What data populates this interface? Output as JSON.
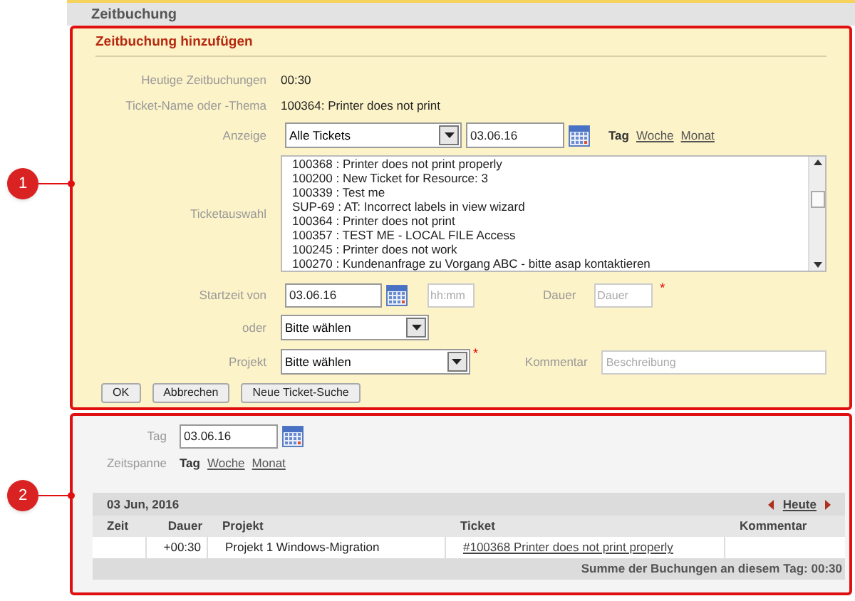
{
  "header": {
    "title": "Zeitbuchung"
  },
  "callouts": [
    "1",
    "2"
  ],
  "form": {
    "title": "Zeitbuchung hinzufügen",
    "today_label": "Heutige Zeitbuchungen",
    "today_value": "00:30",
    "ticket_label": "Ticket-Name oder -Thema",
    "ticket_value": "100364: Printer does not print",
    "display_label": "Anzeige",
    "display_select": "Alle Tickets",
    "display_date": "03.06.16",
    "periods": [
      {
        "label": "Tag",
        "selected": true
      },
      {
        "label": "Woche",
        "selected": false
      },
      {
        "label": "Monat",
        "selected": false
      }
    ],
    "ticketlist_label": "Ticketauswahl",
    "tickets": [
      "100368 : Printer does not print properly",
      "100200 : New Ticket for Resource: 3",
      "100339 : Test me",
      "SUP-69 : AT: Incorrect labels in view wizard",
      "100364 : Printer does not print",
      "100357 : TEST ME - LOCAL FILE Access",
      "100245 : Printer does not work",
      "100270 : Kundenanfrage zu Vorgang ABC - bitte asap kontaktieren"
    ],
    "start_label": "Startzeit von",
    "start_date": "03.06.16",
    "start_time_placeholder": "hh:mm",
    "duration_label": "Dauer",
    "duration_placeholder": "Dauer",
    "required_mark": "*",
    "or_label": "oder",
    "or_select": "Bitte wählen",
    "project_label": "Projekt",
    "project_select": "Bitte wählen",
    "comment_label": "Kommentar",
    "comment_placeholder": "Beschreibung",
    "buttons": [
      "OK",
      "Abbrechen",
      "Neue Ticket-Suche"
    ]
  },
  "overview": {
    "day_label": "Tag",
    "day_date": "03.06.16",
    "span_label": "Zeitspanne",
    "periods": [
      {
        "label": "Tag",
        "selected": true
      },
      {
        "label": "Woche",
        "selected": false
      },
      {
        "label": "Monat",
        "selected": false
      }
    ],
    "date_heading": "03 Jun, 2016",
    "today_link": "Heute",
    "table": {
      "columns": [
        "Zeit",
        "Dauer",
        "Projekt",
        "Ticket",
        "Kommentar"
      ],
      "rows": [
        {
          "zeit": "",
          "dauer": "+00:30",
          "projekt": "Projekt 1 Windows-Migration",
          "ticket": "#100368 Printer does not print properly",
          "kommentar": ""
        }
      ]
    },
    "summary": "Summe der Buchungen an diesem Tag: 00:30"
  }
}
